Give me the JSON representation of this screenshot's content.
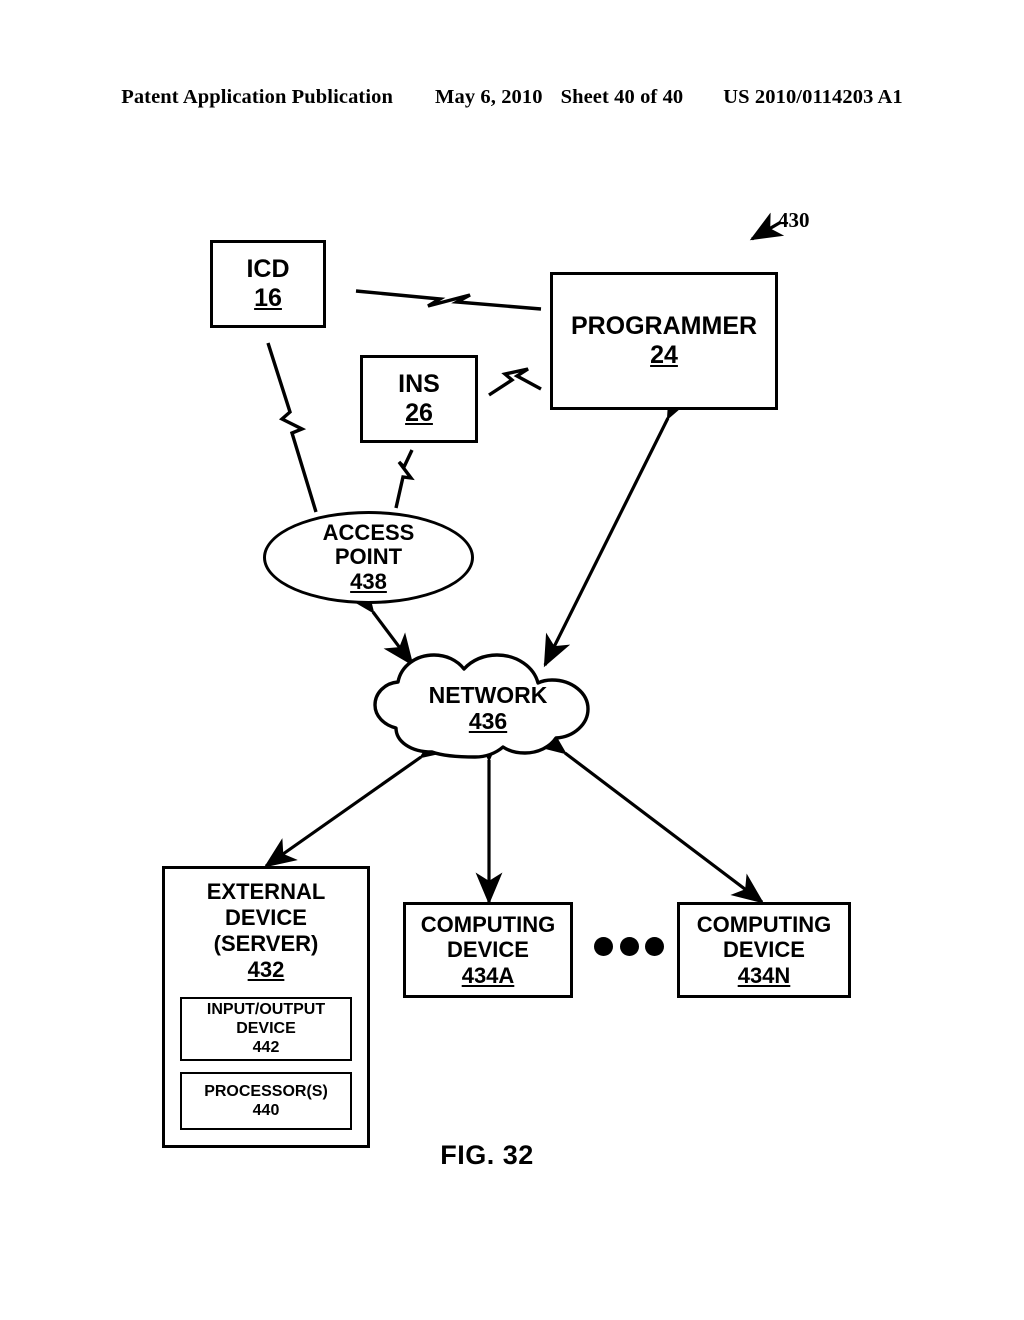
{
  "header": {
    "publication": "Patent Application Publication",
    "date": "May 6, 2010",
    "sheet": "Sheet 40 of 40",
    "patent_number": "US 2010/0114203 A1"
  },
  "figure": {
    "caption": "FIG. 32",
    "system_reference": "430"
  },
  "nodes": {
    "icd": {
      "label": "ICD",
      "ref": "16"
    },
    "ins": {
      "label": "INS",
      "ref": "26"
    },
    "programmer": {
      "label": "PROGRAMMER",
      "ref": "24"
    },
    "access_point": {
      "label_line1": "ACCESS",
      "label_line2": "POINT",
      "ref": "438"
    },
    "network": {
      "label": "NETWORK",
      "ref": "436"
    },
    "external_device": {
      "label_line1": "EXTERNAL",
      "label_line2": "DEVICE",
      "label_line3": "(SERVER)",
      "ref": "432",
      "io_device": {
        "label_line1": "INPUT/OUTPUT",
        "label_line2": "DEVICE",
        "ref": "442"
      },
      "processor": {
        "label": "PROCESSOR(S)",
        "ref": "440"
      }
    },
    "computing_device_a": {
      "label_line1": "COMPUTING",
      "label_line2": "DEVICE",
      "ref": "434A"
    },
    "computing_device_n": {
      "label_line1": "COMPUTING",
      "label_line2": "DEVICE",
      "ref": "434N"
    },
    "ellipsis": {
      "dot_count": 3
    }
  },
  "connectors": [
    {
      "name": "icd-to-programmer",
      "style": "lightning-bolt",
      "from": "icd",
      "to": "programmer"
    },
    {
      "name": "ins-to-programmer",
      "style": "lightning-bolt",
      "from": "ins",
      "to": "programmer"
    },
    {
      "name": "icd-to-access-point",
      "style": "lightning-bolt",
      "from": "icd",
      "to": "access_point"
    },
    {
      "name": "ins-to-access-point",
      "style": "lightning-bolt",
      "from": "ins",
      "to": "access_point"
    },
    {
      "name": "access-point-to-network",
      "style": "double-arrow",
      "from": "access_point",
      "to": "network"
    },
    {
      "name": "programmer-to-network",
      "style": "double-arrow",
      "from": "programmer",
      "to": "network"
    },
    {
      "name": "network-to-external-device",
      "style": "double-arrow",
      "from": "network",
      "to": "external_device"
    },
    {
      "name": "network-to-computing-device-a",
      "style": "double-arrow",
      "from": "network",
      "to": "computing_device_a"
    },
    {
      "name": "network-to-computing-device-n",
      "style": "double-arrow",
      "from": "network",
      "to": "computing_device_n"
    }
  ],
  "colors": {
    "ink": "#000000",
    "paper": "#ffffff"
  }
}
